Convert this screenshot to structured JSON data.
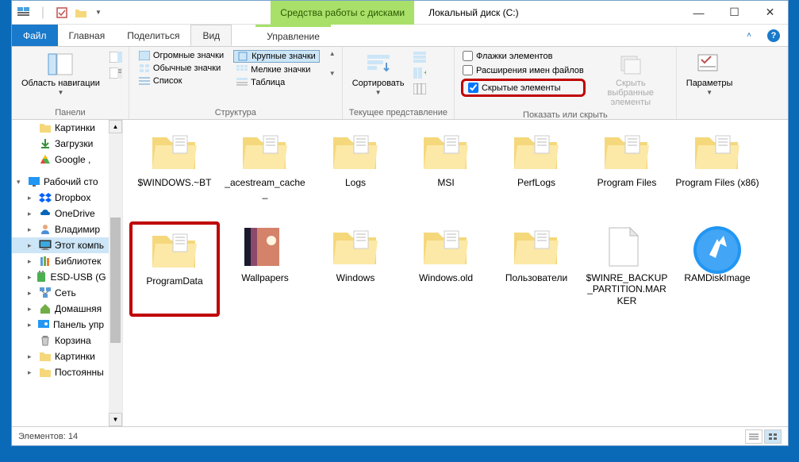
{
  "titlebar": {
    "contextual_label": "Средства работы с дисками",
    "title": "Локальный диск (C:)"
  },
  "tabs": {
    "file": "Файл",
    "home": "Главная",
    "share": "Поделиться",
    "view": "Вид",
    "manage": "Управление"
  },
  "ribbon": {
    "panes_group": "Панели",
    "nav_pane": "Область навигации",
    "layout_group": "Структура",
    "huge_icons": "Огромные значки",
    "large_icons": "Крупные значки",
    "normal_icons": "Обычные значки",
    "small_icons": "Мелкие значки",
    "list": "Список",
    "details": "Таблица",
    "current_view_group": "Текущее представление",
    "sort": "Сортировать",
    "show_hide_group": "Показать или скрыть",
    "item_checkboxes": "Флажки элементов",
    "file_ext": "Расширения имен файлов",
    "hidden_items": "Скрытые элементы",
    "hide_selected": "Скрыть выбранные элементы",
    "options": "Параметры"
  },
  "sidebar": {
    "pictures": "Картинки",
    "downloads": "Загрузки",
    "google": "Google ,",
    "desktop": "Рабочий сто",
    "dropbox": "Dropbox",
    "onedrive": "OneDrive",
    "user": "Владимир",
    "this_pc": "Этот компь",
    "libraries": "Библиотек",
    "esd": "ESD-USB (G",
    "network": "Сеть",
    "homegroup": "Домашняя",
    "control": "Панель упр",
    "recycle": "Корзина",
    "pictures2": "Картинки",
    "perm": "Постоянны"
  },
  "folders": [
    {
      "name": "$WINDOWS.~BT",
      "type": "folder"
    },
    {
      "name": "_acestream_cache_",
      "type": "folder"
    },
    {
      "name": "Logs",
      "type": "folder"
    },
    {
      "name": "MSI",
      "type": "folder"
    },
    {
      "name": "PerfLogs",
      "type": "folder"
    },
    {
      "name": "Program Files",
      "type": "folder"
    },
    {
      "name": "Program Files (x86)",
      "type": "folder"
    },
    {
      "name": "ProgramData",
      "type": "folder",
      "highlighted": true
    },
    {
      "name": "Wallpapers",
      "type": "custom"
    },
    {
      "name": "Windows",
      "type": "folder"
    },
    {
      "name": "Windows.old",
      "type": "folder"
    },
    {
      "name": "Пользователи",
      "type": "folder"
    },
    {
      "name": "$WINRE_BACKUP_PARTITION.MARKER",
      "type": "file"
    },
    {
      "name": "RAMDiskImage",
      "type": "disk"
    }
  ],
  "statusbar": {
    "items": "Элементов: 14"
  }
}
